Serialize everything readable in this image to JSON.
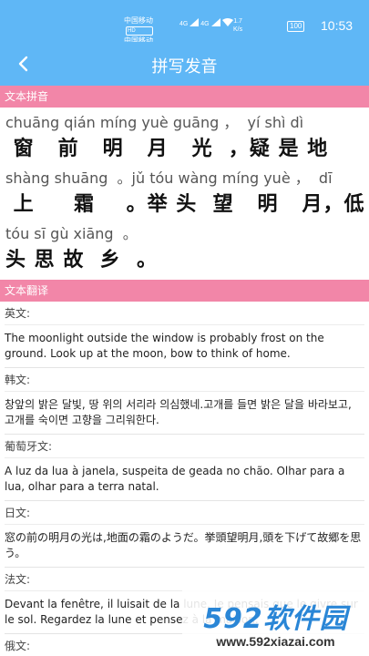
{
  "status_bar": {
    "carrier1": "中国移动",
    "carrier2": "中国移动",
    "hd": "HD",
    "signal": "4G",
    "speed_value": "1.7",
    "speed_unit": "K/s",
    "battery": "100",
    "time": "10:53"
  },
  "header": {
    "title": "拼写发音"
  },
  "pinyin_section": {
    "label": "文本拼音",
    "lines": [
      {
        "pinyin": "chuāng qián míng yuè guāng ，  yí shì dì",
        "hanzi": " 窗   前   明   月   光  ，疑 是 地"
      },
      {
        "pinyin": "shàng shuāng  。jǔ tóu wàng míng yuè ，  dī",
        "hanzi": " 上     霜    。举 头  望   明   月，低"
      },
      {
        "pinyin": "tóu sī gù xiāng  。",
        "hanzi": "头 思 故  乡  。"
      }
    ]
  },
  "translation_section": {
    "label": "文本翻译",
    "items": [
      {
        "lang": "英文:",
        "text": "The moonlight outside the window is probably frost on the ground. Look up at the moon, bow to think of home."
      },
      {
        "lang": "韩文:",
        "text": "창앞의 밝은 달빛, 땅 위의 서리라 의심했네.고개를 들면 밝은 달을 바라보고, 고개를 숙이면 고향을 그리워한다."
      },
      {
        "lang": "葡萄牙文:",
        "text": "A luz da lua à janela, suspeita de geada no chão. Olhar para a lua, olhar para a terra natal."
      },
      {
        "lang": "日文:",
        "text": "窓の前の明月の光は,地面の霜のようだ。挙頭望明月,頭を下げて故郷を思う。"
      },
      {
        "lang": "法文:",
        "text": "Devant la fenêtre, il luisait de la lune. Je pensais que le givre sur le sol. Regardez la lune et pensez à la maison."
      },
      {
        "lang": "俄文:",
        "text": ""
      }
    ]
  },
  "watermark": {
    "logo_num": "592",
    "logo_text": "软件园",
    "url": "www.592xiazai.com"
  }
}
